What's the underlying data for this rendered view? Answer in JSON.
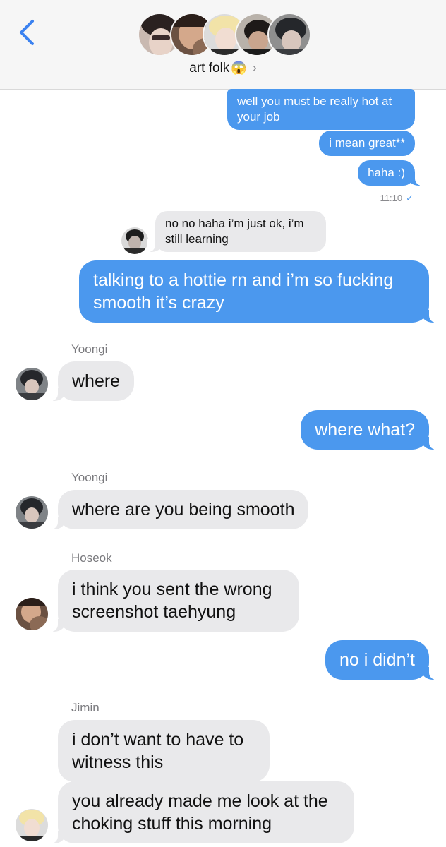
{
  "header": {
    "group_name": "art folk",
    "group_emoji": "😱",
    "chevron": "›",
    "back_icon": "chevron-left-icon",
    "accent": "#3b82f0"
  },
  "messages": [
    {
      "from": "me",
      "text": "well you must be really hot at your job"
    },
    {
      "from": "me",
      "text": "i mean great**"
    },
    {
      "from": "me",
      "text": "haha :)"
    },
    {
      "from": "me",
      "timestamp": "11:10",
      "read_icon": "✓"
    },
    {
      "from": "other",
      "text": "no no haha i’m just ok, i’m still learning"
    },
    {
      "from": "me",
      "text": "talking to a hottie rn and i’m so fucking smooth it’s crazy"
    },
    {
      "from": "Yoongi",
      "sender": "Yoongi",
      "text": "where"
    },
    {
      "from": "me",
      "text": "where what?"
    },
    {
      "from": "Yoongi",
      "sender": "Yoongi",
      "text": "where are you being smooth"
    },
    {
      "from": "Hoseok",
      "sender": "Hoseok",
      "text": "i think you sent the wrong screenshot taehyung"
    },
    {
      "from": "me",
      "text": "no i didn’t"
    },
    {
      "from": "Jimin",
      "sender": "Jimin",
      "text": "i don’t want to have to witness this"
    },
    {
      "from": "Jimin",
      "text": "you already made me look at the choking stuff this morning"
    }
  ],
  "colors": {
    "outgoing_bubble": "#4b98ee",
    "incoming_bubble": "#e9e9eb",
    "header_bg": "#f6f6f6"
  }
}
